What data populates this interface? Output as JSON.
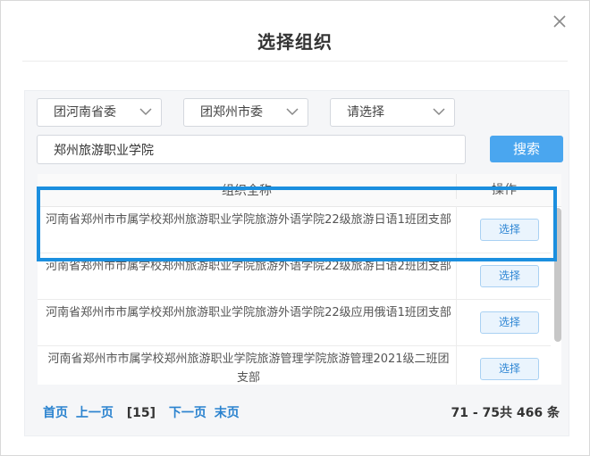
{
  "dialog": {
    "title": "选择组织",
    "close_icon": "close-icon"
  },
  "filters": {
    "province": {
      "value": "团河南省委",
      "icon": "chevron-down-icon"
    },
    "city": {
      "value": "团郑州市委",
      "icon": "chevron-down-icon"
    },
    "third": {
      "value": "请选择",
      "icon": "chevron-down-icon"
    }
  },
  "search": {
    "value": "郑州旅游职业学院",
    "button_label": "搜索"
  },
  "table": {
    "headers": {
      "name": "组织全称",
      "action": "操作"
    },
    "rows": [
      {
        "name": "河南省郑州市市属学校郑州旅游职业学院旅游外语学院22级旅游日语1班团支部",
        "action": "选择",
        "highlighted": true
      },
      {
        "name": "河南省郑州市市属学校郑州旅游职业学院旅游外语学院22级旅游日语2班团支部",
        "action": "选择"
      },
      {
        "name": "河南省郑州市市属学校郑州旅游职业学院旅游外语学院22级应用俄语1班团支部",
        "action": "选择"
      },
      {
        "name": "河南省郑州市市属学校郑州旅游职业学院旅游管理学院旅游管理2021级二班团支部",
        "action": "选择"
      }
    ]
  },
  "pager": {
    "first": "首页",
    "prev": "上一页",
    "current": "[15]",
    "next": "下一页",
    "last": "末页",
    "total": "71 - 75共 466 条"
  },
  "colors": {
    "accent": "#4aa6ef",
    "highlight_border": "#1b8fdf",
    "link": "#2b83cf"
  }
}
